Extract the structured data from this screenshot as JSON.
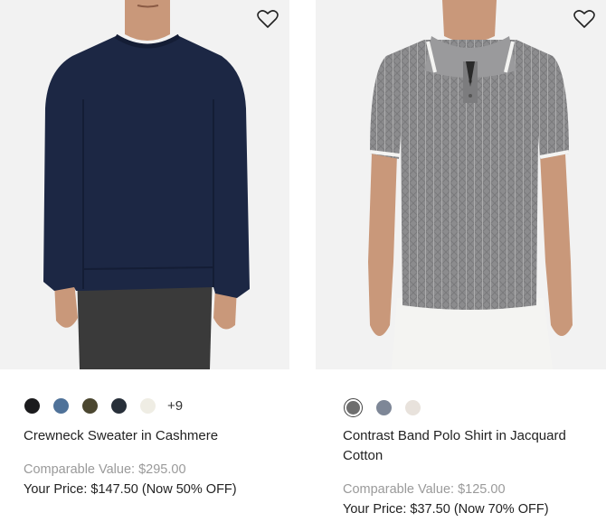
{
  "products": [
    {
      "name": "Crewneck Sweater in Cashmere",
      "swatches": [
        {
          "color": "#1b1b1d"
        },
        {
          "color": "#4f7299"
        },
        {
          "color": "#4b4730"
        },
        {
          "color": "#28303a"
        },
        {
          "color": "#efede4"
        }
      ],
      "more_colors": "+9",
      "comparable_label": "Comparable Value:",
      "comparable_price": "$295.00",
      "your_price_label": "Your Price:",
      "your_price": "$147.50",
      "discount": "(Now 50% OFF)"
    },
    {
      "name": "Contrast Band Polo Shirt in Jacquard Cotton",
      "swatches": [
        {
          "color": "#6e6e6e",
          "selected": true
        },
        {
          "color": "#7e8797"
        },
        {
          "color": "#e8e2dc"
        }
      ],
      "comparable_label": "Comparable Value:",
      "comparable_price": "$125.00",
      "your_price_label": "Your Price:",
      "your_price": "$37.50",
      "discount": "(Now 70% OFF)"
    }
  ],
  "colors": {
    "sweater": "#1c2744",
    "polo": "#8c8c8e",
    "skin": "#c9987a",
    "pants_dark": "#3a3a3a",
    "pants_white": "#f4f4f2"
  },
  "icons": {
    "wishlist": "heart-outline-icon"
  }
}
